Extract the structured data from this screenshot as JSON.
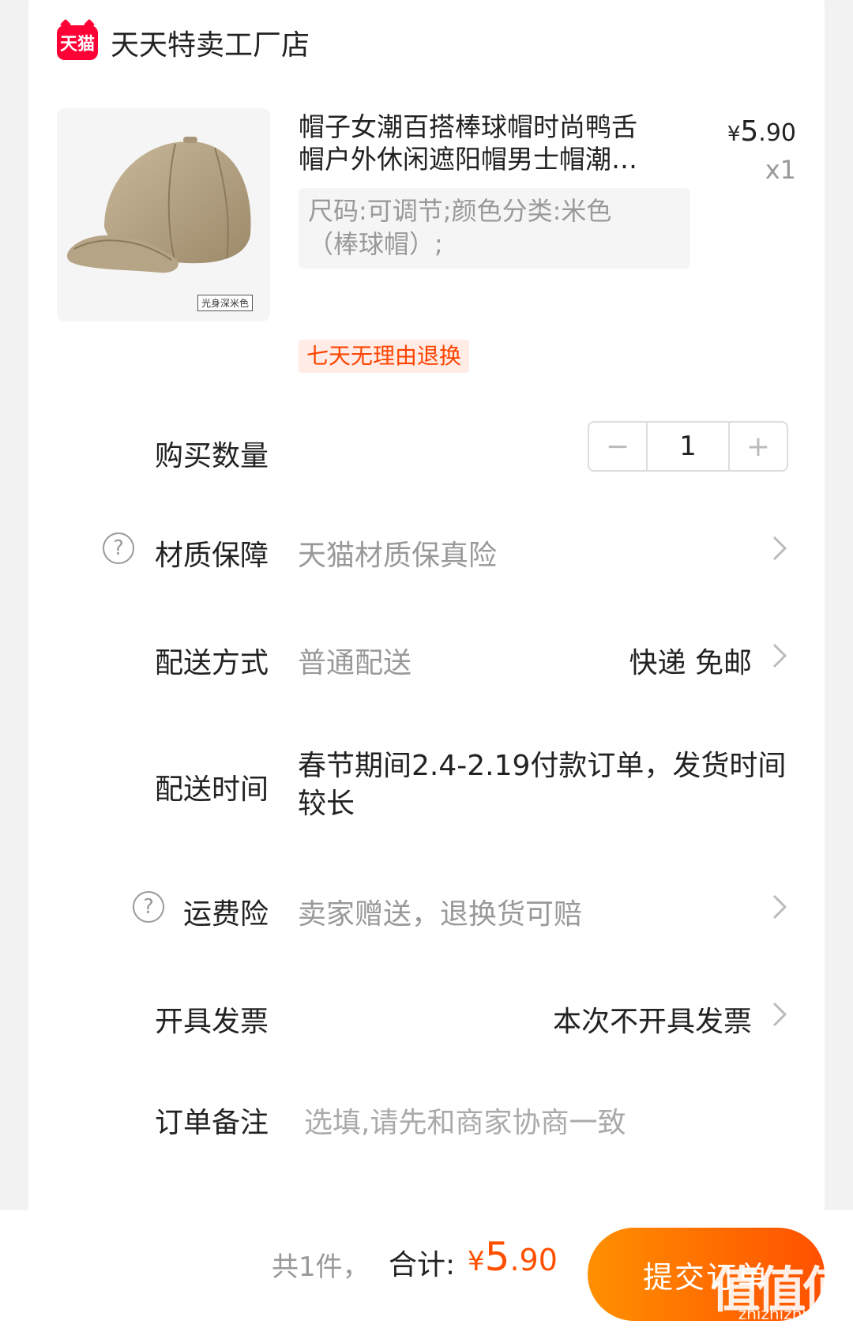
{
  "store": {
    "logo_text": "天猫",
    "name": "天天特卖工厂店"
  },
  "product": {
    "title_line1": "帽子女潮百搭棒球帽时尚鸭舌",
    "title_line2": "帽户外休闲遮阳帽男士帽潮…",
    "price_symbol": "¥",
    "price_int": "5",
    "price_dec": ".90",
    "quantity_mark": "x1",
    "sku_line1": "尺码:可调节;颜色分类:米色",
    "sku_line2": "（棒球帽）;",
    "image_label": "光身深米色",
    "return_tag": "七天无理由退换"
  },
  "rows": {
    "quantity_label": "购买数量",
    "quantity_minus": "−",
    "quantity_value": "1",
    "quantity_plus": "+",
    "material_label": "材质保障",
    "material_value": "天猫材质保真险",
    "shipping_label": "配送方式",
    "shipping_value": "普通配送",
    "shipping_right": "快递 免邮",
    "delivery_time_label": "配送时间",
    "delivery_time_value": "春节期间2.4-2.19付款订单，发货时间较长",
    "freight_label": "运费险",
    "freight_value": "卖家赠送，退换货可赔",
    "invoice_label": "开具发票",
    "invoice_value": "本次不开具发票",
    "remark_label": "订单备注",
    "remark_placeholder": "选填,请先和商家协商一致",
    "help_glyph": "?"
  },
  "bottom": {
    "count_text": "共1件，",
    "total_label": "合计:",
    "total_symbol": "¥",
    "total_int": "5",
    "total_dec": ".90",
    "submit_label": "提交订单",
    "watermark": "值值值",
    "watermark_url": "zhizhizhi.com"
  },
  "colors": {
    "accent": "#ff5000",
    "tmall_red": "#ff0036",
    "muted": "#999999"
  }
}
